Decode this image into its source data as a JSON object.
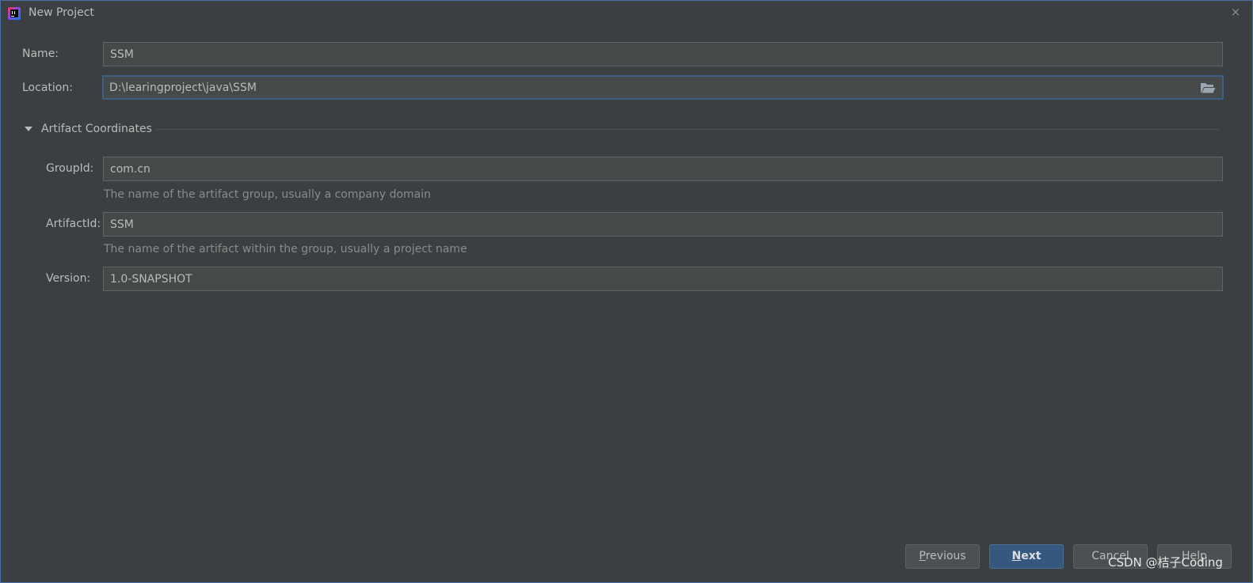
{
  "window": {
    "title": "New Project",
    "app_icon": "intellij-idea-icon",
    "close_icon": "×"
  },
  "form": {
    "name_label": "Name:",
    "name_value": "SSM",
    "location_label": "Location:",
    "location_value": "D:\\learingproject\\java\\SSM",
    "folder_icon": "folder-open-icon"
  },
  "artifact": {
    "section_title": "Artifact Coordinates",
    "expanded": true,
    "group_label": "GroupId:",
    "group_value": "com.cn",
    "group_hint": "The name of the artifact group, usually a company domain",
    "artifact_label": "ArtifactId:",
    "artifact_value": "SSM",
    "artifact_hint": "The name of the artifact within the group, usually a project name",
    "version_label": "Version:",
    "version_value": "1.0-SNAPSHOT"
  },
  "buttons": {
    "previous_mnemonic": "P",
    "previous_rest": "revious",
    "next_mnemonic": "N",
    "next_rest": "ext",
    "cancel": "Cancel",
    "help": "Help"
  },
  "watermark": "CSDN @桔子Coding",
  "colors": {
    "background": "#3c3f41",
    "field_bg": "#45494a",
    "focus_border": "#3d6185",
    "primary_button": "#365880",
    "text": "#bbbbbb",
    "hint_text": "#8a8a8a"
  }
}
